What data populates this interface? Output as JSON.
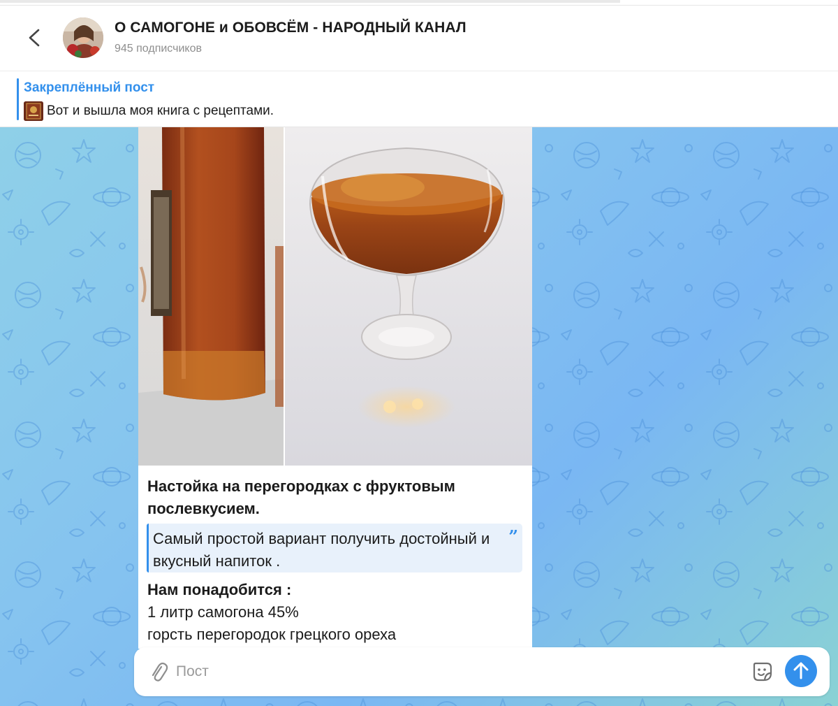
{
  "channel": {
    "title": "О САМОГОНЕ и ОБОВСЁМ - НАРОДНЫЙ КАНАЛ",
    "subscribers": "945 подписчиков"
  },
  "pinned": {
    "label": "Закреплённый пост",
    "text": "Вот и вышла моя книга с рецептами."
  },
  "post": {
    "title": "Настойка на перегородках с фруктовым послевкусием.",
    "quote": "Самый простой вариант получить достойный и вкусный напиток .",
    "quote_mark": "”",
    "need_heading": "Нам понадобится :",
    "ingredients": [
      "1 литр самогона 45%",
      "горсть перегородок грецкого ореха"
    ]
  },
  "composer": {
    "placeholder": "Пост"
  },
  "icons": {
    "back": "chevron-left-icon",
    "attach": "paperclip-icon",
    "sticker": "sticker-icon",
    "send": "arrow-up-icon"
  },
  "colors": {
    "accent": "#3390ec",
    "liquid": "#a04a1e",
    "chat_background": "#86c4ef"
  }
}
